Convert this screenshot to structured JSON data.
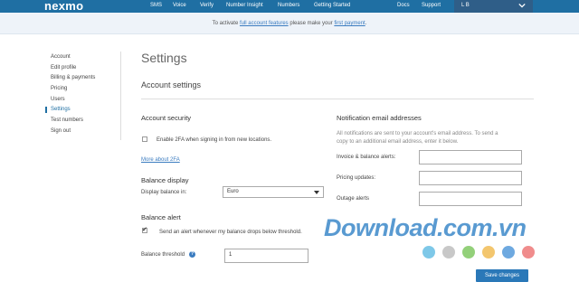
{
  "brand": {
    "logo": "nexmo"
  },
  "topnav": {
    "items": [
      "SMS",
      "Voice",
      "Verify",
      "Number Insight",
      "Numbers",
      "Getting Started",
      "Docs",
      "Support"
    ],
    "user": "L B"
  },
  "banner": {
    "prefix": "To activate ",
    "link1": "full account features",
    "middle": " please make your ",
    "link2": "first payment",
    "suffix": "."
  },
  "sidebar": {
    "items": [
      "Account",
      "Edit profile",
      "Billing & payments",
      "Pricing",
      "Users",
      "Settings",
      "Test numbers",
      "Sign out"
    ],
    "active": "Settings"
  },
  "page": {
    "title": "Settings",
    "section": "Account settings"
  },
  "security": {
    "heading": "Account security",
    "twofa_label": "Enable 2FA when signing in from new locations.",
    "twofa_checked": false,
    "more_link": "More about 2FA"
  },
  "balance_display": {
    "heading": "Balance display",
    "label": "Display balance in:",
    "value": "Euro"
  },
  "balance_alert": {
    "heading": "Balance alert",
    "checkbox_label": "Send an alert whenever my balance drops below threshold.",
    "checked": true,
    "threshold_label": "Balance threshold",
    "threshold_value": "1"
  },
  "notification": {
    "heading": "Notification email addresses",
    "desc1": "All notifications are sent to your account's email address. To send a",
    "desc2": "copy to an additional email address, enter it below.",
    "invoice_label": "Invoice & balance alerts:",
    "pricing_label": "Pricing updates:",
    "outage_label": "Outage alerts",
    "invoice_value": "",
    "pricing_value": "",
    "outage_value": ""
  },
  "save_button": "Save changes",
  "watermark": {
    "text": "Download.com.vn",
    "dot_colors": [
      "#7ec8e8",
      "#c8c8c8",
      "#93d07a",
      "#f3c66e",
      "#6ea9e0",
      "#f08c8c"
    ]
  }
}
